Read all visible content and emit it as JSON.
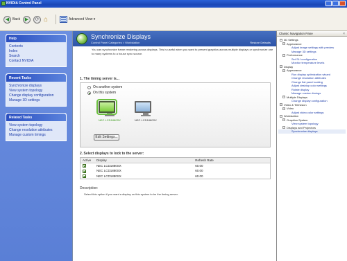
{
  "window": {
    "title": "NVIDIA Control Panel"
  },
  "toolbar": {
    "back_label": "Back",
    "view_label": "Advanced View ▾"
  },
  "sidebar": {
    "help": {
      "title": "Help",
      "items": [
        "Contents",
        "Index",
        "Search",
        "Contact NVIDIA"
      ]
    },
    "recent": {
      "title": "Recent Tasks",
      "items": [
        "Synchronize displays",
        "View system topology",
        "Change display configuration",
        "Manage 3D settings"
      ]
    },
    "related": {
      "title": "Related Tasks",
      "items": [
        "View system topology",
        "Change resolution attributes",
        "Manage custom timings"
      ]
    }
  },
  "main": {
    "title": "Synchronize Displays",
    "breadcrumb": "Control Panel Categories  >  Workstation",
    "restore": "Restore Defaults",
    "intro": "You can synchronize frame rendering across displays. This is useful when you want to present graphics across multiple displays or synchronize one to many systems to a house sync source.",
    "section1": {
      "title": "1. The timing server is...",
      "option_other": "On another system",
      "option_this": "On this system",
      "monitors": [
        "NEC LCD1880SX",
        "NEC LCD1880SX"
      ],
      "edit_button": "Edit Settings..."
    },
    "section2": {
      "title": "2. Select displays to lock to the server:",
      "columns": [
        "Active",
        "Display",
        "Refresh Rate"
      ],
      "rows": [
        [
          "NEC LCD1880SX",
          "60.00"
        ],
        [
          "NEC LCD1880SX",
          "60.00"
        ],
        [
          "NEC LCD1880SX",
          "60.00"
        ]
      ]
    },
    "description_label": "Description:",
    "description_text": "Select this option if you want a display on this system to be the timing server."
  },
  "navpane": {
    "title": "Classic Navigation Pane",
    "close": "×",
    "tree": [
      {
        "level": 1,
        "label": "3D Settings"
      },
      {
        "level": 2,
        "label": "Appearance"
      },
      {
        "level": 3,
        "label": "Adjust image settings with preview"
      },
      {
        "level": 3,
        "label": "Manage 3D settings"
      },
      {
        "level": 2,
        "label": "Performance"
      },
      {
        "level": 3,
        "label": "Set SLI configuration"
      },
      {
        "level": 3,
        "label": "Monitor temperature levels"
      },
      {
        "level": 1,
        "label": "Display"
      },
      {
        "level": 2,
        "label": "Appearance"
      },
      {
        "level": 3,
        "label": "Run display optimization wizard"
      },
      {
        "level": 3,
        "label": "Change resolution attributes"
      },
      {
        "level": 3,
        "label": "Change flat panel scaling"
      },
      {
        "level": 3,
        "label": "Adjust desktop color settings"
      },
      {
        "level": 3,
        "label": "Rotate display"
      },
      {
        "level": 3,
        "label": "Manage custom timings"
      },
      {
        "level": 2,
        "label": "Multiple Displays"
      },
      {
        "level": 3,
        "label": "Change display configuration"
      },
      {
        "level": 1,
        "label": "Video & Television"
      },
      {
        "level": 2,
        "label": "Video"
      },
      {
        "level": 3,
        "label": "Adjust video color settings"
      },
      {
        "level": 1,
        "label": "Workstation"
      },
      {
        "level": 2,
        "label": "Graphics System"
      },
      {
        "level": 3,
        "label": "View system topology"
      },
      {
        "level": 2,
        "label": "Displays and Projectors"
      },
      {
        "level": 3,
        "label": "Synchronize displays"
      }
    ]
  },
  "colors": {
    "sidebar": "#5a7fd6",
    "header": "#2d54a8",
    "accent_green": "#6cc040"
  }
}
